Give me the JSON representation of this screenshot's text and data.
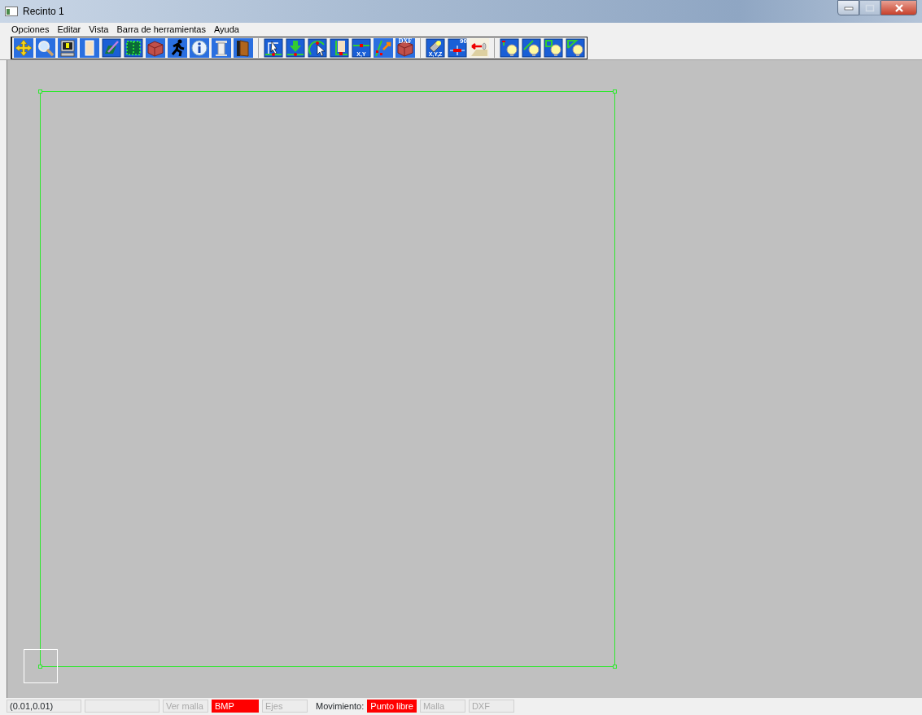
{
  "window": {
    "title": "Recinto 1",
    "controls": [
      {
        "kind": "minimize"
      },
      {
        "kind": "maximize",
        "disabled": true
      },
      {
        "kind": "close"
      }
    ]
  },
  "menu": [
    "Opciones",
    "Editar",
    "Vista",
    "Barra de herramientas",
    "Ayuda"
  ],
  "toolbar": [
    [
      {
        "kind": "move"
      },
      {
        "kind": "search"
      },
      {
        "kind": "monitor"
      },
      {
        "kind": "page"
      },
      {
        "kind": "pencil"
      },
      {
        "kind": "grid"
      },
      {
        "kind": "brick"
      },
      {
        "kind": "runner"
      },
      {
        "kind": "info"
      },
      {
        "kind": "column"
      },
      {
        "kind": "door"
      }
    ],
    [
      {
        "kind": "pointer"
      },
      {
        "kind": "download"
      },
      {
        "kind": "cursor"
      },
      {
        "kind": "wall"
      },
      {
        "kind": "axes",
        "text": "X,Y"
      },
      {
        "kind": "transform"
      },
      {
        "kind": "brick",
        "text": "DXF"
      }
    ],
    [
      {
        "kind": "flashlight",
        "text": "X,Y,Z"
      },
      {
        "kind": "rotate",
        "text": "90"
      },
      {
        "kind": "arrow"
      }
    ],
    [
      {
        "kind": "bulb-point"
      },
      {
        "kind": "bulb-line"
      },
      {
        "kind": "bulb-square"
      },
      {
        "kind": "bulb-poly"
      }
    ]
  ],
  "canvas": {
    "kind": "drawing"
  },
  "status_bar": [
    {
      "text": "(0.01,0.01)",
      "kind": "field",
      "on": false,
      "disabled": false
    },
    {
      "kind": "field",
      "on": false,
      "disabled": false
    },
    {
      "text": "Ver malla",
      "kind": "field",
      "on": false,
      "disabled": true
    },
    {
      "text": "BMP",
      "kind": "field",
      "on": true,
      "disabled": false
    },
    {
      "text": "Ejes",
      "kind": "field",
      "on": false,
      "disabled": true
    },
    {
      "text": "Movimiento:",
      "kind": "label"
    },
    {
      "text": "Punto libre",
      "kind": "field",
      "on": true,
      "disabled": false
    },
    {
      "text": "Malla",
      "kind": "field",
      "on": false,
      "disabled": true
    },
    {
      "text": "DXF",
      "kind": "field",
      "on": false,
      "disabled": true
    }
  ]
}
